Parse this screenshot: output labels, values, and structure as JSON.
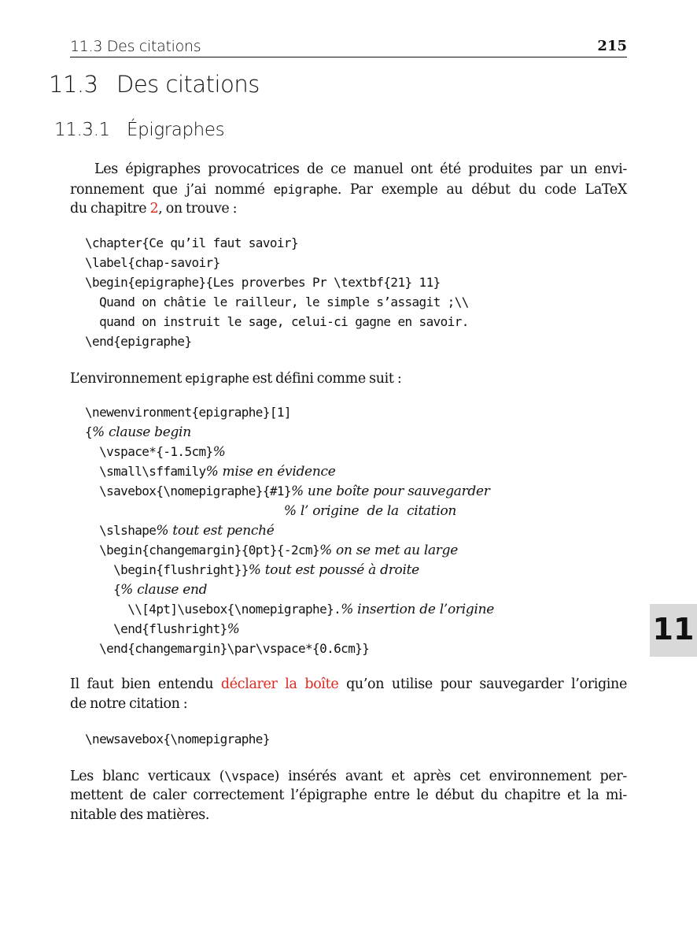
{
  "header": {
    "running_title": "11.3 Des citations",
    "page_number": "215"
  },
  "section": {
    "number": "11.3",
    "title": "Des citations"
  },
  "subsection": {
    "number": "11.3.1",
    "title": "Épigraphes"
  },
  "para1": {
    "line1": "Les épigraphes provocatrices de ce manuel ont été produites par un envi-",
    "line2_a": "ronnement que j’ai nommé ",
    "line2_code": "epigraphe",
    "line2_b": ". Par exemple au début du code ",
    "latex_logo": "LaTeX",
    "line3_a": "du chapitre ",
    "line3_ref": "2",
    "line3_b": ", on trouve :"
  },
  "code1": [
    "\\chapter{Ce qu’il faut savoir}",
    "\\label{chap-savoir}",
    "\\begin{epigraphe}{Les proverbes Pr \\textbf{21} 11}",
    "  Quand on châtie le railleur, le simple s’assagit ;\\\\",
    "  quand on instruit le sage, celui-ci gagne en savoir.",
    "\\end{epigraphe}"
  ],
  "para2": {
    "a": "L’environnement ",
    "code": "epigraphe",
    "b": " est défini comme suit :"
  },
  "code2": [
    {
      "code": "\\newenvironment{epigraphe}[1]",
      "comment": ""
    },
    {
      "code": "{",
      "comment": "% clause begin"
    },
    {
      "code": "  \\vspace*{-1.5cm}",
      "comment": "%"
    },
    {
      "code": "  \\small\\sffamily",
      "comment": "% mise en évidence"
    },
    {
      "code": "  \\savebox{\\nomepigraphe}{#1}",
      "comment": "% une boîte pour sauvegarder"
    },
    {
      "code": "                            ",
      "comment": "% l’ origine  de la  citation"
    },
    {
      "code": "  \\slshape",
      "comment": "% tout est penché"
    },
    {
      "code": "  \\begin{changemargin}{0pt}{-2cm}",
      "comment": "% on se met au large"
    },
    {
      "code": "    \\begin{flushright}}",
      "comment": "% tout est poussé à droite"
    },
    {
      "code": "    {",
      "comment": "% clause end"
    },
    {
      "code": "      \\\\[4pt]\\usebox{\\nomepigraphe}.",
      "comment": "% insertion de l’origine"
    },
    {
      "code": "    \\end{flushright}",
      "comment": "%"
    },
    {
      "code": "  \\end{changemargin}\\par\\vspace*{0.6cm}}",
      "comment": ""
    }
  ],
  "para3": {
    "line1_a": "Il faut bien entendu ",
    "line1_ref": "déclarer la boîte",
    "line1_b": " qu’on utilise pour sauvegarder l’origine",
    "line2": "de notre citation :"
  },
  "code3": [
    "\\newsavebox{\\nomepigraphe}"
  ],
  "para4": {
    "line1_a": "Les blanc verticaux (",
    "line1_code": "\\vspace",
    "line1_b": ") insérés avant et après cet environnement per-",
    "line2": "mettent de caler correctement l’épigraphe entre le début du chapitre et la mi-",
    "line3": "nitable des matières."
  },
  "thumb_tab": "11",
  "colors": {
    "reference": "#e0261e",
    "thumb_background": "#d9d9d9"
  }
}
